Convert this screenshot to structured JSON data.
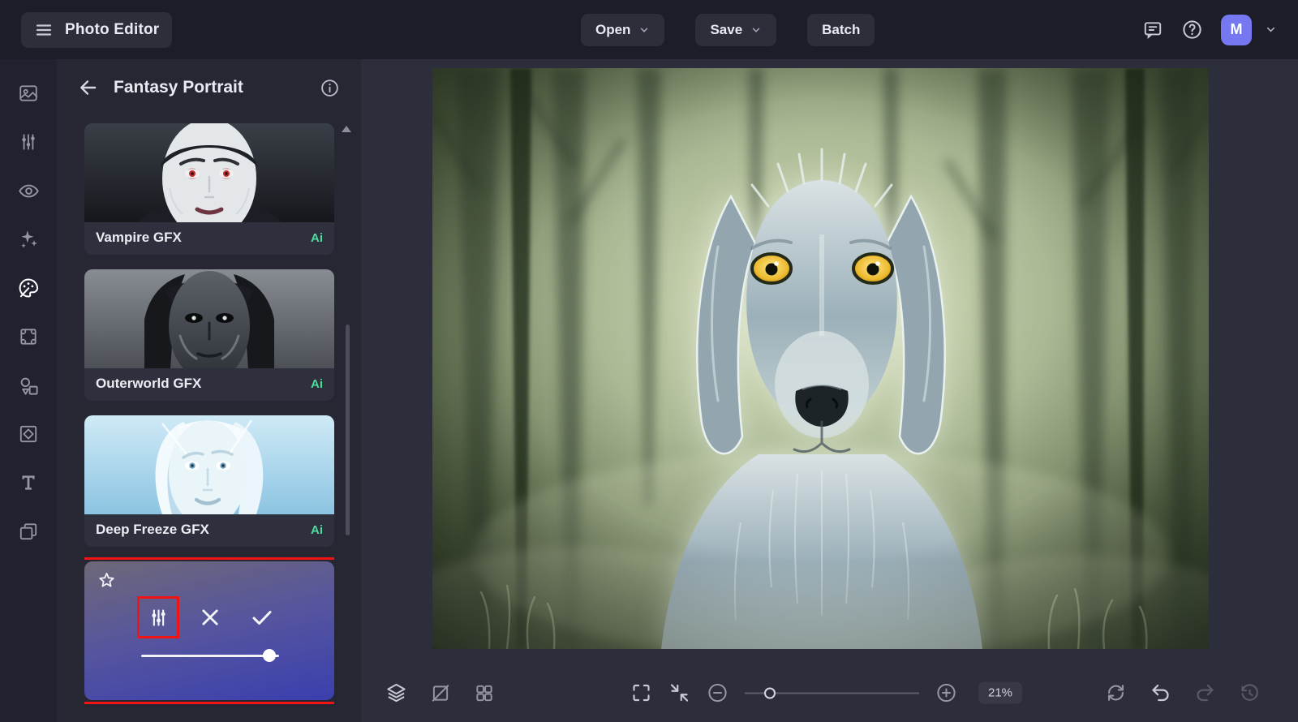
{
  "app": {
    "title": "Photo Editor"
  },
  "topbar": {
    "open": "Open",
    "save": "Save",
    "batch": "Batch",
    "avatar_initial": "M",
    "icons": [
      "menu-icon",
      "chevron-down-icon",
      "feedback-icon",
      "help-icon"
    ]
  },
  "rail": {
    "icons": [
      "photos-icon",
      "adjustments-icon",
      "preview-eye-icon",
      "effects-sparkles-icon",
      "paint-palette-icon",
      "canvas-frame-icon",
      "elements-shapes-icon",
      "frames-icon",
      "text-icon",
      "overlays-icon"
    ],
    "active": "paint-palette-icon"
  },
  "panel": {
    "title": "Fantasy Portrait",
    "header_icons": [
      "back-arrow-icon",
      "info-icon"
    ],
    "filters": [
      {
        "label": "Vampire GFX",
        "badge": "Ai"
      },
      {
        "label": "Outerworld GFX",
        "badge": "Ai"
      },
      {
        "label": "Deep Freeze GFX",
        "badge": "Ai"
      }
    ],
    "selected_filter": {
      "icons": [
        "favorite-star-icon",
        "adjust-settings-icon",
        "cancel-icon",
        "apply-icon"
      ],
      "strength_percent": 93
    }
  },
  "canvas": {
    "subject": "ghostly-dog-forest-portrait",
    "toolbar": {
      "zoom_value": "21%",
      "left_icons": [
        "layers-icon",
        "transform-icon",
        "grid-view-icon"
      ],
      "center_icons": [
        "fit-screen-icon",
        "exit-fullscreen-icon",
        "zoom-out-icon",
        "zoom-in-icon"
      ],
      "right_icons": [
        "reset-rotate-icon",
        "undo-icon",
        "redo-icon",
        "history-icon"
      ]
    }
  },
  "annotations": {
    "highlight_color": "#f01414"
  },
  "colors": {
    "accent": "#7678f2",
    "ai_badge": "#4ade9c",
    "selected_gradient_top": "#6e6878",
    "selected_gradient_bottom": "#3a3fae"
  }
}
